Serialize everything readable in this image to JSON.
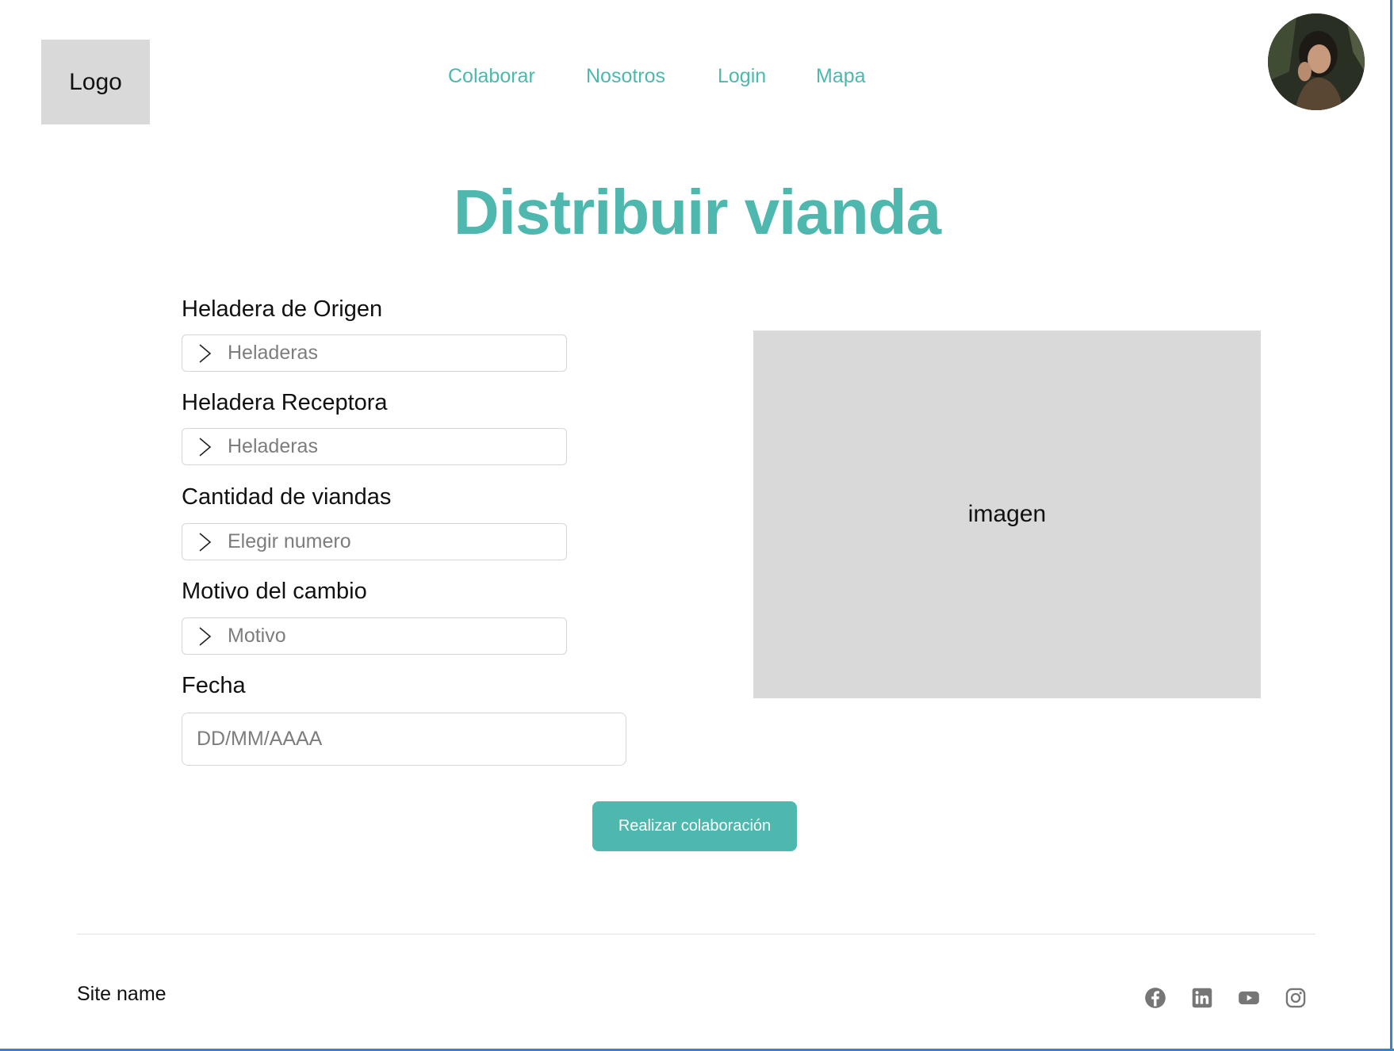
{
  "header": {
    "logo": "Logo",
    "nav": [
      {
        "label": "Colaborar"
      },
      {
        "label": "Nosotros"
      },
      {
        "label": "Login"
      },
      {
        "label": "Mapa"
      }
    ]
  },
  "page": {
    "title": "Distribuir vianda"
  },
  "form": {
    "fields": [
      {
        "label": "Heladera de Origen",
        "placeholder": "Heladeras"
      },
      {
        "label": "Heladera Receptora",
        "placeholder": "Heladeras"
      },
      {
        "label": "Cantidad de viandas",
        "placeholder": "Elegir numero"
      },
      {
        "label": "Motivo del cambio",
        "placeholder": "Motivo"
      }
    ],
    "date": {
      "label": "Fecha",
      "placeholder": "DD/MM/AAAA"
    },
    "submit_label": "Realizar colaboración"
  },
  "image_placeholder": "imagen",
  "footer": {
    "site_name": "Site name",
    "social_icons": [
      "facebook-icon",
      "linkedin-icon",
      "youtube-icon",
      "instagram-icon"
    ]
  },
  "colors": {
    "accent": "#4eb8ae",
    "placeholder_gray": "#d9d9d9",
    "frame": "#3f7fd0"
  }
}
